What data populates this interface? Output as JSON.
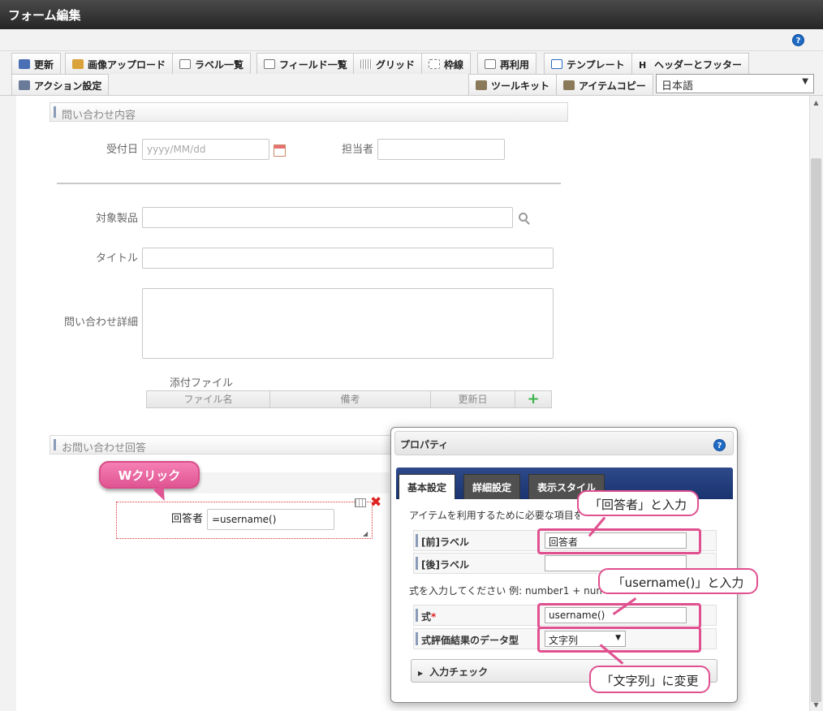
{
  "window": {
    "title": "フォーム編集"
  },
  "toolbar": {
    "row1": [
      "更新",
      "画像アップロード",
      "ラベル一覧",
      "フィールド一覧",
      "グリッド",
      "枠線",
      "再利用",
      "テンプレート",
      "ヘッダーとフッター"
    ],
    "row2": [
      "アクション設定",
      "ツールキット",
      "アイテムコピー"
    ],
    "language": "日本語",
    "header_icon_glyph": "H"
  },
  "form": {
    "section1": "問い合わせ内容",
    "received_date_label": "受付日",
    "received_date_placeholder": "yyyy/MM/dd",
    "assignee_label": "担当者",
    "product_label": "対象製品",
    "title_label": "タイトル",
    "detail_label": "問い合わせ詳細",
    "attachment_label": "添付ファイル",
    "attachment_columns": [
      "ファイル名",
      "備考",
      "更新日"
    ],
    "section2": "お問い合わせ回答",
    "answerer_label": "回答者",
    "answerer_value": "=username()"
  },
  "panel": {
    "title": "プロパティ",
    "tabs": [
      "基本設定",
      "詳細設定",
      "表示スタイル"
    ],
    "description1": "アイテムを利用するために必要な項目を設",
    "pre_label_label": "[前]ラベル",
    "pre_label_value": "回答者",
    "post_label_label": "[後]ラベル",
    "post_label_value": "",
    "description2": "式を入力してください 例: number1 + numbe",
    "formula_label": "式",
    "formula_required": "*",
    "formula_value": "username()",
    "datatype_label": "式評価結果のデータ型",
    "datatype_value": "文字列",
    "input_check": "入力チェック"
  },
  "callouts": {
    "double_click": "Wクリック",
    "enter_answerer": "「回答者」と入力",
    "enter_username": "「username()」と入力",
    "change_string": "「文字列」に変更"
  },
  "colors": {
    "accent": "#e0508f",
    "tab_bar": "#1f3a7a",
    "titlebar": "#333333"
  }
}
